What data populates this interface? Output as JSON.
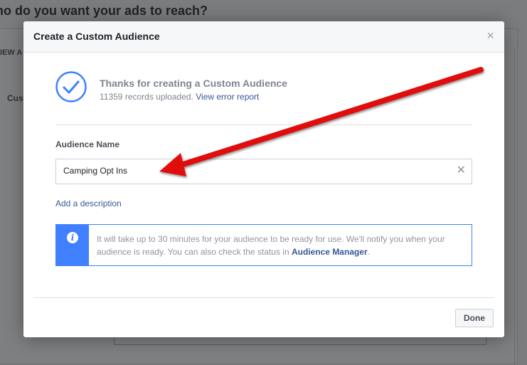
{
  "background": {
    "page_title": "ho do you want your ads to reach?",
    "left_label_1": "IEW A",
    "left_label_2": "Cus"
  },
  "modal": {
    "title": "Create a Custom Audience",
    "close_glyph": "×",
    "success_title": "Thanks for creating a Custom Audience",
    "records_text": "11359 records uploaded.",
    "error_link": "View error report",
    "name_label": "Audience Name",
    "name_value": "Camping Opt Ins",
    "clear_glyph": "✕",
    "add_description": "Add a description",
    "info_icon": "i",
    "info_text_1": "It will take up to 30 minutes for your audience to be ready for use. We'll notify you when your audience is ready. You can also check the status in ",
    "info_link": "Audience Manager",
    "info_text_2": ".",
    "done_label": "Done"
  },
  "icons": {
    "success": "check-circle-icon",
    "info": "info-icon",
    "close": "close-icon",
    "clear": "clear-icon"
  },
  "colors": {
    "accent": "#4080ff",
    "link": "#365899",
    "arrow": "#e0110c"
  }
}
